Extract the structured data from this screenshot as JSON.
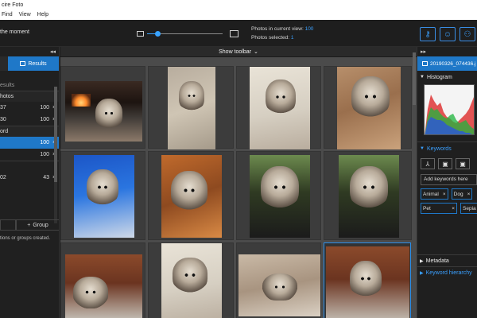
{
  "app": {
    "title": "cire Foto"
  },
  "menu": {
    "items": [
      "Find",
      "View",
      "Help"
    ]
  },
  "toolbar": {
    "moment_text": "the moment",
    "zoom_fraction": 0.14,
    "in_view_label": "Photos in current view:",
    "in_view_count": "100",
    "selected_label": "Photos selected:",
    "selected_count": "1"
  },
  "right_buttons": [
    {
      "name": "key-icon",
      "glyph": "⚷"
    },
    {
      "name": "face-icon",
      "glyph": "☺"
    },
    {
      "name": "people-icon",
      "glyph": "⚇"
    }
  ],
  "left_panel": {
    "collapse_glyph": "◂◂",
    "results_tab": "Results",
    "results_heading": "esults",
    "section_photos": "hotos",
    "rows_a": [
      {
        "label": "37",
        "count": "100",
        "close": "×"
      },
      {
        "label": "30",
        "count": "100",
        "close": "×"
      }
    ],
    "section_word": "ord",
    "rows_b": [
      {
        "label": "",
        "count": "100",
        "close": "×",
        "selected": true
      },
      {
        "label": "",
        "count": "100",
        "close": "×",
        "selected": false
      }
    ],
    "row_c": {
      "label": "02",
      "count": "43",
      "close": "×"
    },
    "group_button": "Group",
    "group_plus": "+",
    "footer": "tions or groups created."
  },
  "center": {
    "show_toolbar": "Show toolbar",
    "show_toolbar_chevron": "⌄"
  },
  "right_panel": {
    "expand_glyph": "▸▸",
    "filename": "20190326_074436.j",
    "histogram_title": "Histogram",
    "keywords_title": "Keywords",
    "kw_buttons": [
      "⅄",
      "▣",
      "▣"
    ],
    "kw_placeholder": "Add keywords here",
    "tags": [
      {
        "label": "Animal",
        "close": "×"
      },
      {
        "label": "Dog",
        "close": "×"
      },
      {
        "label": "Pet",
        "close": "×"
      },
      {
        "label": "Sepia",
        "close": "×"
      }
    ],
    "metadata_title": "Metadata",
    "hierarchy_title": "Keyword hierarchy"
  },
  "colors": {
    "accent": "#1f78c8",
    "accent_text": "#3aa0ff",
    "background": "#1b1b1b",
    "grid_bg": "#4b4b4b"
  }
}
